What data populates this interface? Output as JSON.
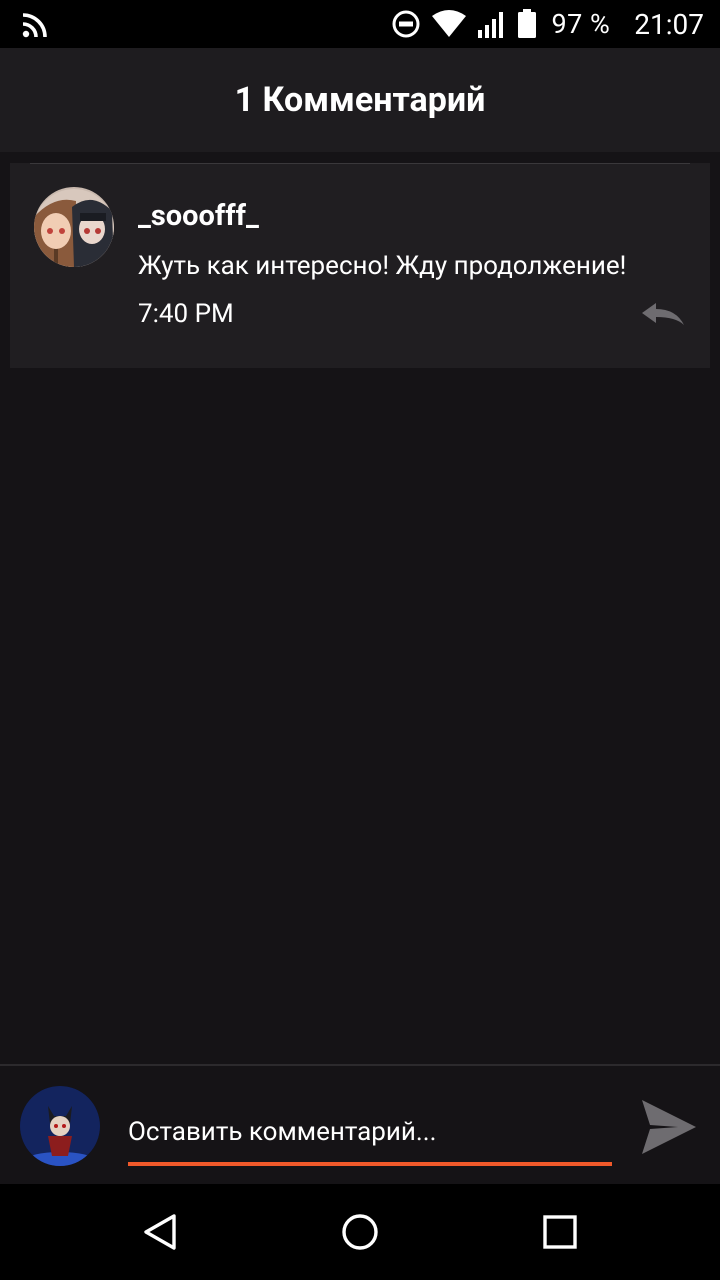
{
  "statusbar": {
    "battery_percent": "97 %",
    "time": "21:07",
    "icons": [
      "rss-icon",
      "dnd-icon",
      "wifi-icon",
      "signal-icon",
      "battery-icon"
    ]
  },
  "header": {
    "title": "1 Комментарий"
  },
  "comments": [
    {
      "username": "_sooofff_",
      "text": "Жуть как интересно! Жду продолжение!",
      "time": "7:40 PM",
      "avatar_icon": "user-avatar"
    }
  ],
  "composer": {
    "placeholder": "Оставить комментарий...",
    "send_icon": "send-icon",
    "accent_color": "#f0592a"
  },
  "navbar": {
    "icons": [
      "back-icon",
      "home-icon",
      "recents-icon"
    ]
  }
}
